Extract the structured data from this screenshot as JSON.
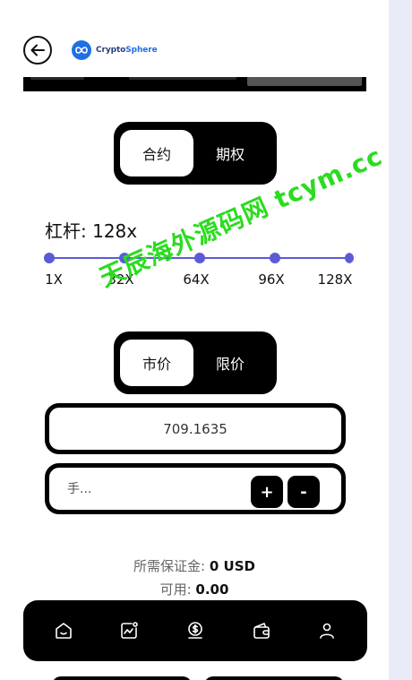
{
  "header": {
    "back_icon": "arrow-left-icon",
    "logo_name_part1": "Crypto",
    "logo_name_part2": "Sphere"
  },
  "contract_type": {
    "options": [
      "合约",
      "期权"
    ],
    "selected": "合约"
  },
  "leverage": {
    "label": "杠杆: 128x",
    "ticks": [
      "1X",
      "32X",
      "64X",
      "96X",
      "128X"
    ],
    "value_fraction": 1.0
  },
  "order_type": {
    "options": [
      "市价",
      "限价"
    ],
    "selected": "市价"
  },
  "price": {
    "value": "709.1635"
  },
  "quantity": {
    "placeholder": "手...",
    "plus_label": "+",
    "minus_label": "-"
  },
  "summary": {
    "margin_label": "所需保证金:",
    "margin_value": "0 USD",
    "available_label": "可用:",
    "available_value": "0.00"
  },
  "watermark_text": "天辰海外源码网 tcym.cc",
  "bottom_nav": [
    {
      "icon": "home-icon"
    },
    {
      "icon": "chart-icon"
    },
    {
      "icon": "dollar-coin-icon"
    },
    {
      "icon": "wallet-icon"
    },
    {
      "icon": "user-icon"
    }
  ],
  "colors": {
    "accent": "#5b5bd6",
    "watermark": "#2bdc1f",
    "dark": "#000000"
  }
}
